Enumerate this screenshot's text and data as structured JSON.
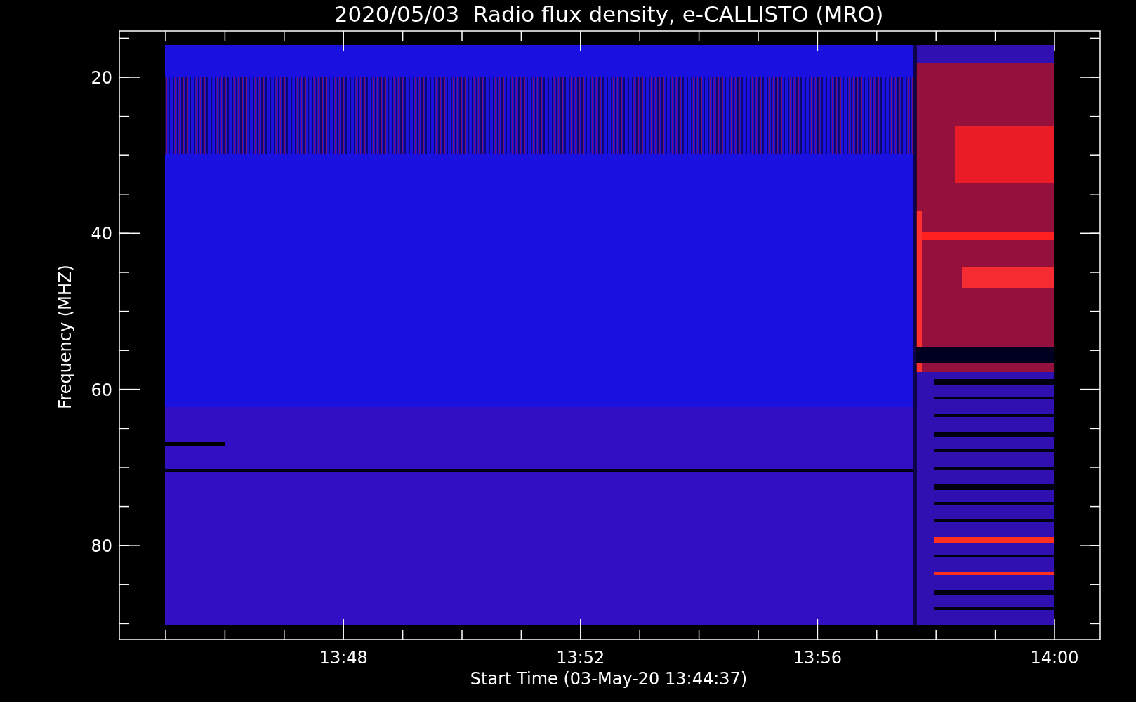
{
  "title": "2020/05/03  Radio flux density, e-CALLISTO (MRO)",
  "y_axis": {
    "label": "Frequency (MHZ)",
    "ticks": [
      "20",
      "40",
      "60",
      "80"
    ]
  },
  "x_axis": {
    "label": "Start Time (03-May-20 13:44:37)",
    "ticks": [
      "13:48",
      "13:52",
      "13:56",
      "14:00"
    ]
  }
}
